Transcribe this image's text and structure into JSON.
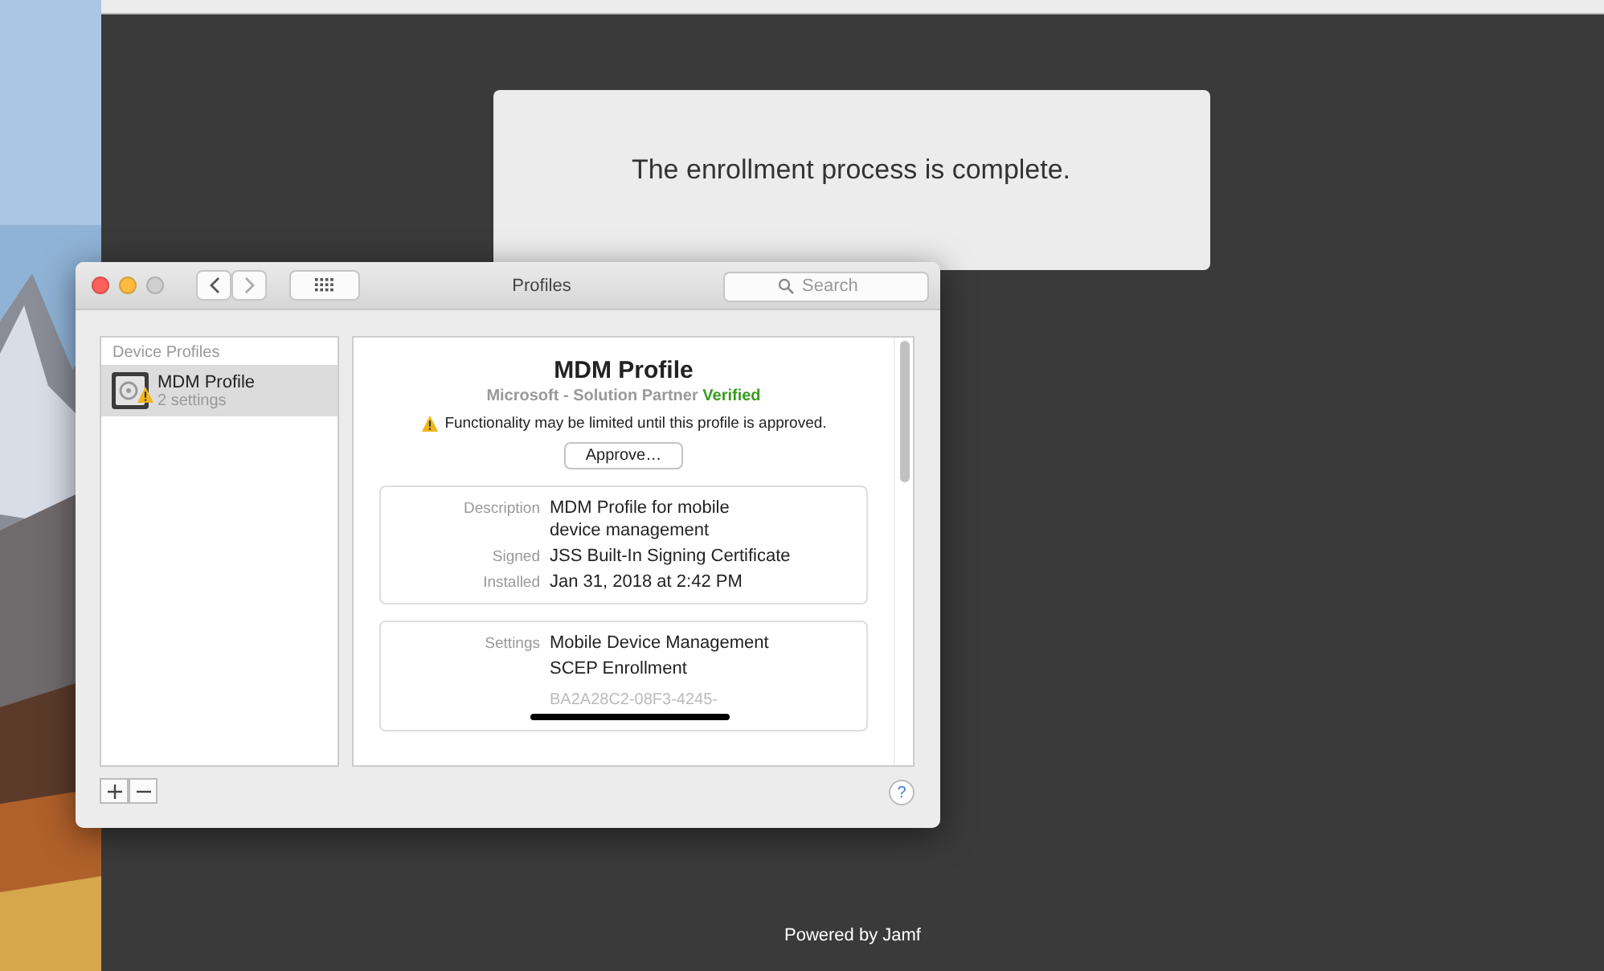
{
  "browser": {
    "message": "The enrollment process is complete.",
    "footer": "Powered by Jamf"
  },
  "window": {
    "title": "Profiles",
    "search": {
      "placeholder": "Search"
    },
    "help_button": "?"
  },
  "sidebar": {
    "heading": "Device Profiles",
    "items": [
      {
        "name": "MDM Profile",
        "subtitle": "2 settings",
        "selected": true,
        "warning": true
      }
    ]
  },
  "profile": {
    "title": "MDM Profile",
    "publisher": "Microsoft - Solution Partner",
    "verified": "Verified",
    "warning": "Functionality may be limited until this profile is approved.",
    "approve_button": "Approve…",
    "details": [
      {
        "label": "Description",
        "value": "MDM Profile for mobile device management"
      },
      {
        "label": "Signed",
        "value": "JSS Built-In Signing Certificate"
      },
      {
        "label": "Installed",
        "value": "Jan 31, 2018 at 2:42 PM"
      }
    ],
    "settings": {
      "label": "Settings",
      "values": [
        "Mobile Device Management",
        "SCEP Enrollment"
      ],
      "uuid": "BA2A28C2-08F3-4245-",
      "redacted": true
    }
  }
}
